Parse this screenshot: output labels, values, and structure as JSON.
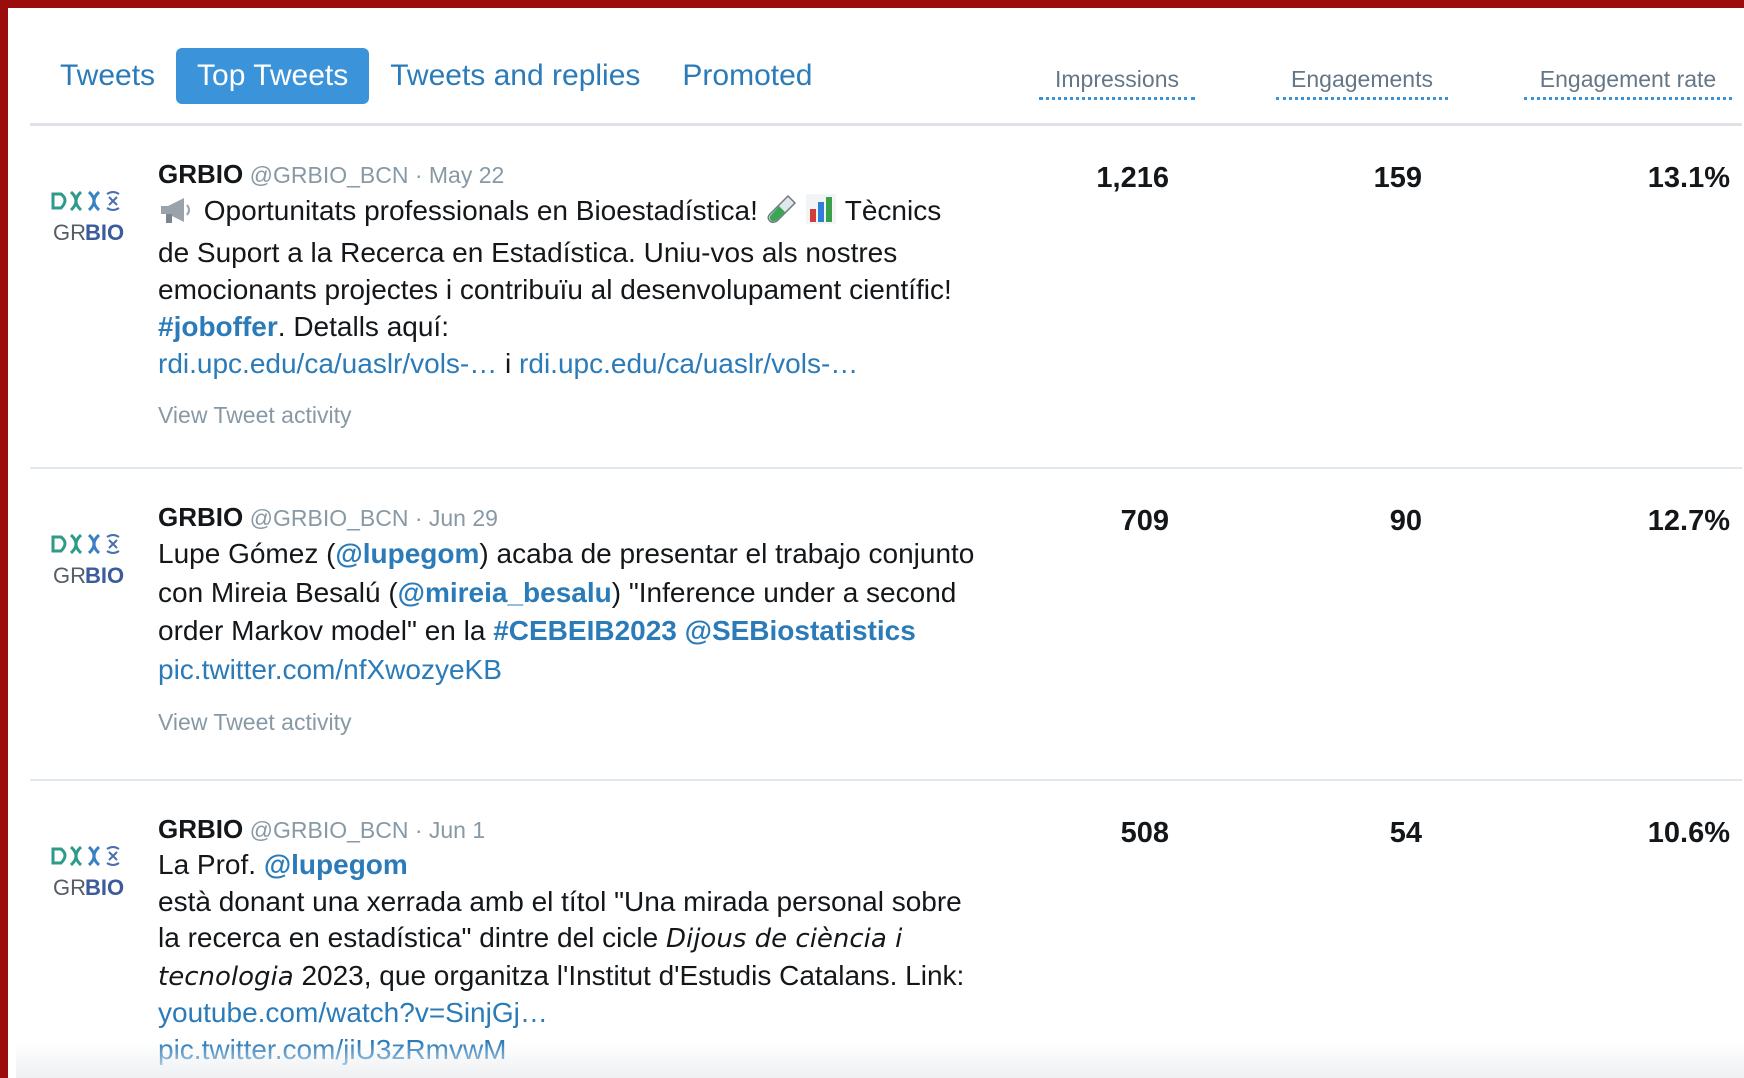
{
  "tabs": [
    {
      "label": "Tweets",
      "active": false
    },
    {
      "label": "Top Tweets",
      "active": true
    },
    {
      "label": "Tweets and replies",
      "active": false
    },
    {
      "label": "Promoted",
      "active": false
    }
  ],
  "metrics": {
    "impressions": "Impressions",
    "engagements": "Engagements",
    "engagement_rate": "Engagement rate"
  },
  "colors": {
    "accent": "#3b94d9",
    "link": "#2b7bb9",
    "frame": "#9b0d0d"
  },
  "tweets": [
    {
      "name": "GRBIO",
      "handle": "@GRBIO_BCN",
      "date": "· May 22",
      "avatar_alt": "GRBIO",
      "icons": [
        "megaphone-icon",
        "test-tube-icon",
        "bar-chart-icon"
      ],
      "segments": {
        "s1": "Oportunitats professionals en Bioestadística!",
        "s2": "Tècnics de Suport a la Recerca en Estadística. Uniu-vos als nostres emocionants projectes i contribuïu al desenvolupament científic! ",
        "hashtag": "#joboffer",
        "s3": ". Detalls aquí: ",
        "link1": "rdi.upc.edu/ca/uaslr/vols-…",
        "s4": " i ",
        "link2": "rdi.upc.edu/ca/uaslr/vols-…"
      },
      "activity": "View Tweet activity",
      "impressions": "1,216",
      "engagements": "159",
      "engagement_rate": "13.1%"
    },
    {
      "name": "GRBIO",
      "handle": "@GRBIO_BCN",
      "date": "· Jun 29",
      "avatar_alt": "GRBIO",
      "segments": {
        "s1": "Lupe Gómez (",
        "mention1": "@lupegom",
        "s2": ") acaba de presentar el trabajo conjunto con Mireia Besalú (",
        "mention2": "@mireia_besalu",
        "s3": ") \"Inference under a second order Markov model\" en la ",
        "hashtag": "#CEBEIB2023",
        "s4": " ",
        "mention3": "@SEBiostatistics",
        "s5": " ",
        "link1": "pic.twitter.com/nfXwozyeKB"
      },
      "activity": "View Tweet activity",
      "impressions": "709",
      "engagements": "90",
      "engagement_rate": "12.7%"
    },
    {
      "name": "GRBIO",
      "handle": "@GRBIO_BCN",
      "date": "· Jun 1",
      "avatar_alt": "GRBIO",
      "segments": {
        "s1": "La Prof. ",
        "mention1": "@lupegom",
        "s2": "està donant una xerrada amb el títol \"Una mirada personal sobre la recerca en estadística\" dintre del cicle ",
        "italic": "Dijous de ciència i tecnologia",
        "s3": " 2023, que organitza l'Institut d'Estudis Catalans. Link: ",
        "link1": "youtube.com/watch?v=SinjGj…",
        "link2": "pic.twitter.com/jiU3zRmvwM"
      },
      "impressions": "508",
      "engagements": "54",
      "engagement_rate": "10.6%"
    }
  ]
}
